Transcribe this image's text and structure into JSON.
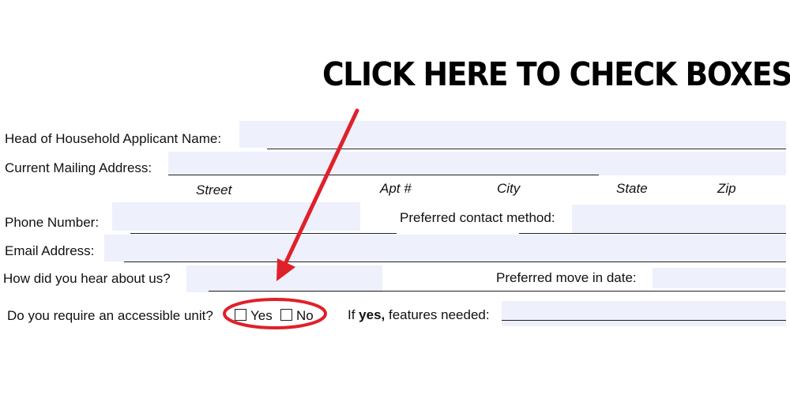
{
  "banner": {
    "headline": "CLICK HERE TO CHECK BOXES"
  },
  "form": {
    "head_name_label": "Head of Household Applicant Name:",
    "mailing_label": "Current Mailing Address:",
    "address_parts": {
      "street": "Street",
      "apt": "Apt #",
      "city": "City",
      "state": "State",
      "zip": "Zip"
    },
    "phone_label": "Phone Number:",
    "contact_method_label": "Preferred contact method:",
    "email_label": "Email Address:",
    "hear_label": "How did you hear about us?",
    "move_in_label": "Preferred move in date:",
    "accessible_label": "Do you require an accessible unit?",
    "yes_label": "Yes",
    "no_label": "No",
    "features_if": "If ",
    "features_yes": "yes,",
    "features_rest": " features needed:",
    "values": {
      "head_name": "",
      "mailing": "",
      "phone": "",
      "contact_method": "",
      "email": "",
      "hear": "",
      "move_in": "",
      "features": ""
    },
    "accessible_yes_checked": false,
    "accessible_no_checked": false
  },
  "colors": {
    "field_fill": "#eef0fc",
    "annotation": "#e0202a"
  },
  "annotation": {
    "arrow": "red-arrow-icon",
    "circle": "red-ellipse-highlight"
  }
}
